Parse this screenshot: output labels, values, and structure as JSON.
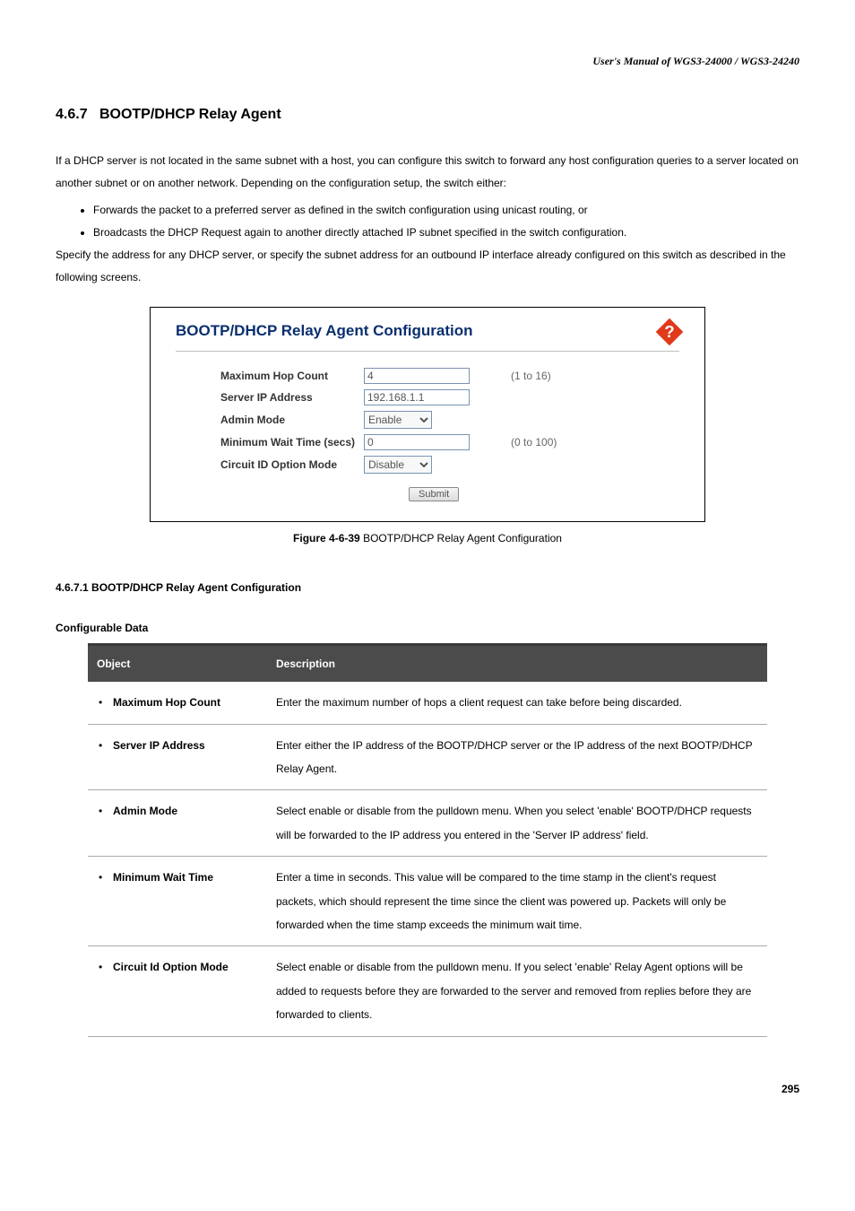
{
  "header": "User's  Manual  of  WGS3-24000  /  WGS3-24240",
  "section": {
    "number": "4.6.7",
    "title": "BOOTP/DHCP Relay Agent"
  },
  "intro": "If a DHCP server is not located in the same subnet with a host, you can configure this switch to forward any host configuration queries to a server located on another subnet or on another network. Depending on the configuration setup, the switch either:",
  "bullets": [
    "Forwards the packet to a preferred server as defined in the switch configuration using unicast routing, or",
    "Broadcasts the DHCP Request again to another directly attached IP subnet specified in the switch configuration."
  ],
  "after_bullets": "Specify the address for any DHCP server, or specify the subnet address for an outbound IP interface already configured on this switch as described in the following screens.",
  "figure": {
    "title": "BOOTP/DHCP Relay Agent Configuration",
    "rows": [
      {
        "label": "Maximum Hop Count",
        "type": "input",
        "value": "4",
        "hint": "(1 to 16)"
      },
      {
        "label": "Server IP Address",
        "type": "input",
        "value": "192.168.1.1",
        "hint": ""
      },
      {
        "label": "Admin Mode",
        "type": "select",
        "value": "Enable",
        "hint": ""
      },
      {
        "label": "Minimum Wait Time (secs)",
        "type": "input",
        "value": "0",
        "hint": "(0 to 100)"
      },
      {
        "label": "Circuit ID Option Mode",
        "type": "select",
        "value": "Disable",
        "hint": ""
      }
    ],
    "submit": "Submit",
    "caption_bold": "Figure 4-6-39",
    "caption_rest": " BOOTP/DHCP Relay Agent Configuration"
  },
  "subsection": {
    "heading": "4.6.7.1 BOOTP/DHCP Relay Agent Configuration",
    "subhead2": "Configurable Data"
  },
  "table": {
    "head": {
      "object": "Object",
      "description": "Description"
    },
    "rows": [
      {
        "object": "Maximum Hop Count",
        "description": "Enter the maximum number of hops a client request can take before being discarded."
      },
      {
        "object": "Server IP Address",
        "description": "Enter either the IP address of the BOOTP/DHCP server or the IP address of the next BOOTP/DHCP Relay Agent."
      },
      {
        "object": "Admin Mode",
        "description": "Select enable or disable from the pulldown menu. When you select 'enable' BOOTP/DHCP requests will be forwarded to the IP address you entered in the 'Server IP address' field."
      },
      {
        "object": "Minimum Wait Time",
        "description": "Enter a time in seconds. This value will be compared to the time stamp in the client's request packets, which should represent the time since the client was powered up. Packets will only be forwarded when the time stamp exceeds the minimum wait time."
      },
      {
        "object": "Circuit Id Option Mode",
        "description": "Select enable or disable from the pulldown menu. If you select 'enable' Relay Agent options will be added to requests before they are forwarded to the server and removed from replies before they are forwarded to clients."
      }
    ]
  },
  "page_number": "295"
}
